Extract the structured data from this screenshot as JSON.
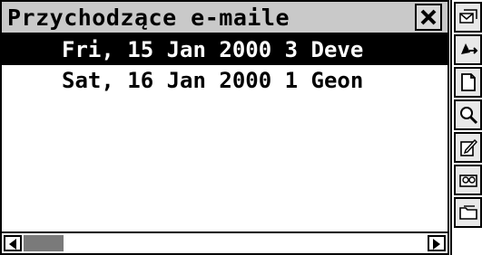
{
  "window": {
    "title": "Przychodzące e-maile",
    "close_icon": "close-x-icon"
  },
  "emails": [
    {
      "text": "Fri, 15 Jan 2000 3 Deve",
      "selected": true
    },
    {
      "text": "Sat, 16 Jan 2000 1 Geon",
      "selected": false
    }
  ],
  "toolbar": {
    "icons": [
      "envelopes-icon",
      "send-mail-icon",
      "new-document-icon",
      "search-icon",
      "edit-icon",
      "address-book-icon",
      "folder-icon"
    ]
  },
  "colors": {
    "selection": "#000000",
    "titlebar": "#c9c9c9",
    "scroll_thumb": "#7a7a7a"
  }
}
